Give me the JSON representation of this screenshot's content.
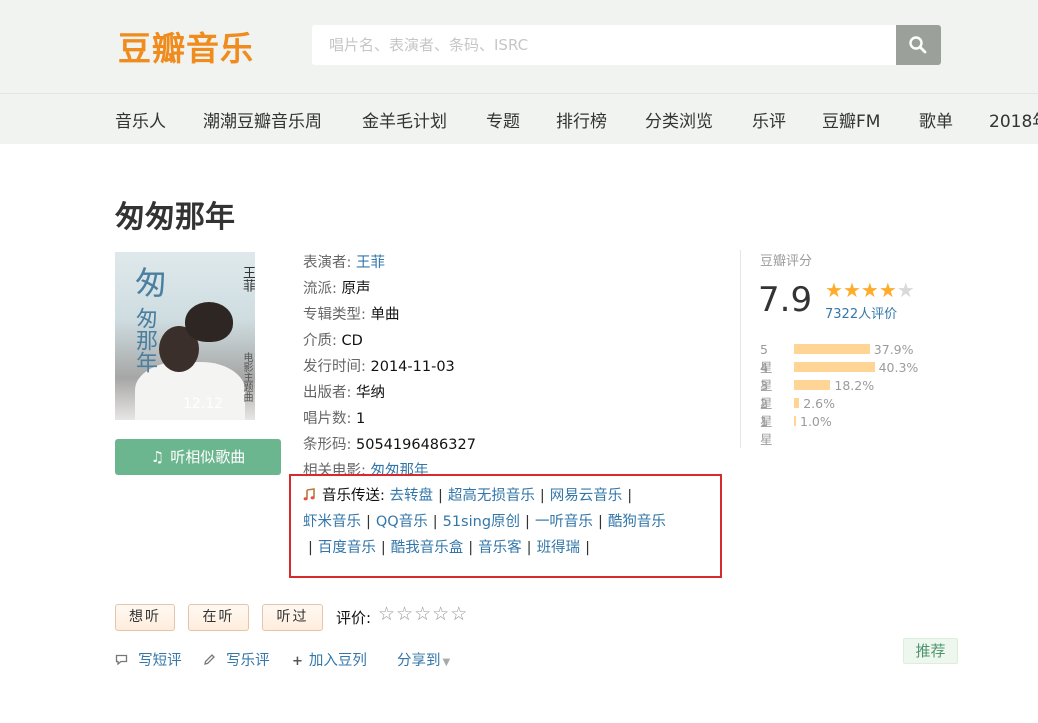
{
  "header": {
    "logo": "豆瓣音乐",
    "search_placeholder": "唱片名、表演者、条码、ISRC",
    "nav": [
      "音乐人",
      "潮潮豆瓣音乐周",
      "金羊毛计划",
      "专题",
      "排行榜",
      "分类浏览",
      "乐评",
      "豆瓣FM",
      "歌单",
      "2018年"
    ]
  },
  "album": {
    "title": "匆匆那年",
    "cover_text": {
      "big": "匆",
      "vertical": "匆那年",
      "artist": "王菲",
      "sub": "电影主题曲",
      "date": "12.12"
    },
    "listen_button": "听相似歌曲"
  },
  "info": [
    {
      "label": "表演者:",
      "value": "王菲",
      "link": true
    },
    {
      "label": "流派:",
      "value": "原声",
      "link": false
    },
    {
      "label": "专辑类型:",
      "value": "单曲",
      "link": false
    },
    {
      "label": "介质:",
      "value": "CD",
      "link": false
    },
    {
      "label": "发行时间:",
      "value": "2014-11-03",
      "link": false
    },
    {
      "label": "出版者:",
      "value": "华纳",
      "link": false
    },
    {
      "label": "唱片数:",
      "value": "1",
      "link": false
    },
    {
      "label": "条形码:",
      "value": "5054196486327",
      "link": false
    },
    {
      "label": "相关电影:",
      "value": "匆匆那年",
      "link": true
    }
  ],
  "music_send": {
    "label": "音乐传送:",
    "line1": [
      "去转盘",
      "超高无损音乐",
      "网易云音乐"
    ],
    "line2": [
      "虾米音乐",
      "QQ音乐",
      "51sing原创",
      "一听音乐",
      "酷狗音乐"
    ],
    "line3": [
      "百度音乐",
      "酷我音乐盒",
      "音乐客",
      "班得瑞"
    ]
  },
  "rating": {
    "label": "豆瓣评分",
    "score": "7.9",
    "stars_filled": 4,
    "count": "7322人评价",
    "distribution": [
      {
        "label": "5星",
        "percent": 37.9,
        "text": "37.9%"
      },
      {
        "label": "4星",
        "percent": 40.3,
        "text": "40.3%"
      },
      {
        "label": "3星",
        "percent": 18.2,
        "text": "18.2%"
      },
      {
        "label": "2星",
        "percent": 2.6,
        "text": "2.6%"
      },
      {
        "label": "1星",
        "percent": 1.0,
        "text": "1.0%"
      }
    ]
  },
  "actions": {
    "want": "想听",
    "listening": "在听",
    "listened": "听过",
    "rate_label": "评价:",
    "short_review": "写短评",
    "music_review": "写乐评",
    "add_doulist": "加入豆列",
    "share": "分享到",
    "recommend": "推荐"
  },
  "colors": {
    "brand": "#f08c1e",
    "link": "#3377aa",
    "listen_button": "#6cb68f",
    "star": "#ffac2d",
    "bar": "#ffd596",
    "highlight_box": "#d72a2a"
  }
}
